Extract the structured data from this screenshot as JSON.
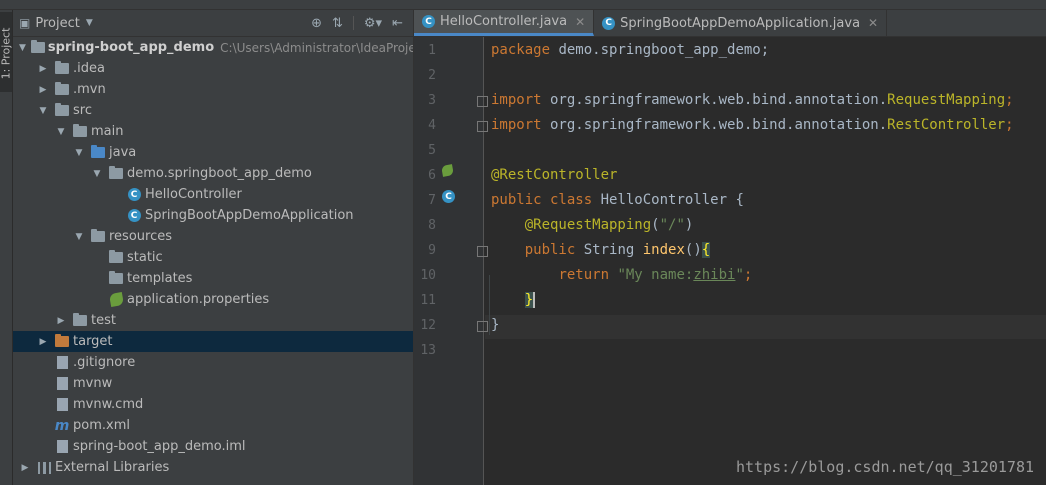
{
  "tool_strip": {
    "project_tab": "1: Project"
  },
  "project_panel": {
    "title": "Project",
    "tree": [
      {
        "label": "spring-boot_app_demo",
        "path": "C:\\Users\\Administrator\\IdeaProjects\\",
        "depth": 0,
        "expanded": true,
        "icon": "module-folder",
        "bold": true
      },
      {
        "label": ".idea",
        "depth": 1,
        "expanded": false,
        "icon": "folder"
      },
      {
        "label": ".mvn",
        "depth": 1,
        "expanded": false,
        "icon": "folder"
      },
      {
        "label": "src",
        "depth": 1,
        "expanded": true,
        "icon": "folder"
      },
      {
        "label": "main",
        "depth": 2,
        "expanded": true,
        "icon": "folder"
      },
      {
        "label": "java",
        "depth": 3,
        "expanded": true,
        "icon": "source-folder"
      },
      {
        "label": "demo.springboot_app_demo",
        "depth": 4,
        "expanded": true,
        "icon": "package-folder"
      },
      {
        "label": "HelloController",
        "depth": 5,
        "icon": "class-icon"
      },
      {
        "label": "SpringBootAppDemoApplication",
        "depth": 5,
        "icon": "spring-class-icon"
      },
      {
        "label": "resources",
        "depth": 3,
        "expanded": true,
        "icon": "resources-folder"
      },
      {
        "label": "static",
        "depth": 4,
        "icon": "folder"
      },
      {
        "label": "templates",
        "depth": 4,
        "icon": "folder"
      },
      {
        "label": "application.properties",
        "depth": 4,
        "icon": "spring-leaf-icon"
      },
      {
        "label": "test",
        "depth": 2,
        "expanded": false,
        "icon": "folder"
      },
      {
        "label": "target",
        "depth": 1,
        "expanded": false,
        "icon": "excluded-folder",
        "selected": true
      },
      {
        "label": ".gitignore",
        "depth": 1,
        "icon": "file"
      },
      {
        "label": "mvnw",
        "depth": 1,
        "icon": "file"
      },
      {
        "label": "mvnw.cmd",
        "depth": 1,
        "icon": "file"
      },
      {
        "label": "pom.xml",
        "depth": 1,
        "icon": "maven-icon"
      },
      {
        "label": "spring-boot_app_demo.iml",
        "depth": 1,
        "icon": "file"
      },
      {
        "label": "External Libraries",
        "depth": 0,
        "expanded": false,
        "icon": "libraries-icon"
      }
    ]
  },
  "editor": {
    "tabs": [
      {
        "label": "HelloController.java",
        "active": true
      },
      {
        "label": "SpringBootAppDemoApplication.java",
        "active": false
      }
    ],
    "line_numbers": [
      "1",
      "2",
      "3",
      "4",
      "5",
      "6",
      "7",
      "8",
      "9",
      "10",
      "11",
      "12",
      "13"
    ],
    "code": {
      "l1_kw": "package",
      "l1_rest": " demo.springboot_app_demo;",
      "l3_kw": "import",
      "l3_pkg": " org.springframework.web.bind.annotation.",
      "l3_cls": "RequestMapping",
      "l3_end": ";",
      "l4_kw": "import",
      "l4_pkg": " org.springframework.web.bind.annotation.",
      "l4_cls": "RestController",
      "l4_end": ";",
      "l6_ann": "@RestController",
      "l7_kw": "public class",
      "l7_rest": " HelloController {",
      "l8_ann": "@RequestMapping",
      "l8_open": "(",
      "l8_str": "\"/\"",
      "l8_close": ")",
      "l9_kw": "public",
      "l9_type": " String ",
      "l9_fn": "index",
      "l9_parens": "()",
      "l9_brace": "{",
      "l10_kw": "return",
      "l10_str_a": "\"My name:",
      "l10_str_b": "zhibi",
      "l10_str_c": "\"",
      "l10_end": ";",
      "l11_brace": "}",
      "l12_brace": "}"
    }
  },
  "watermark": "https://blog.csdn.net/qq_31201781"
}
